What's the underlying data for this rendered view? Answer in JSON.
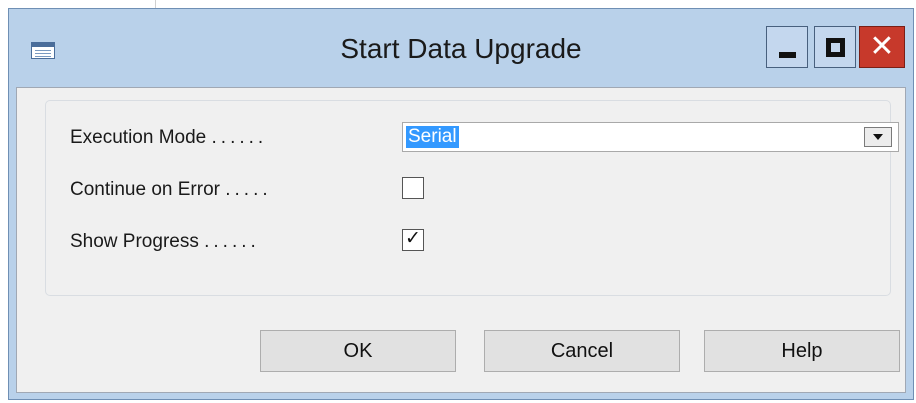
{
  "window": {
    "title": "Start Data Upgrade",
    "icon": "form-icon",
    "controls": {
      "minimize": "minimize-icon",
      "maximize": "maximize-icon",
      "close_glyph": "✕"
    }
  },
  "fields": {
    "execution_mode": {
      "label": "Execution Mode",
      "dots": "......",
      "value": "Serial"
    },
    "continue_on_error": {
      "label": "Continue on Error",
      "dots": ".....",
      "checked": false
    },
    "show_progress": {
      "label": "Show Progress",
      "dots": "......",
      "checked": true,
      "check_glyph": "✓"
    }
  },
  "buttons": {
    "ok": "OK",
    "cancel": "Cancel",
    "help": "Help"
  },
  "colors": {
    "frame": "#b9d1ea",
    "close": "#c7392b",
    "selection": "#3399ff",
    "client": "#f0f0f0"
  }
}
